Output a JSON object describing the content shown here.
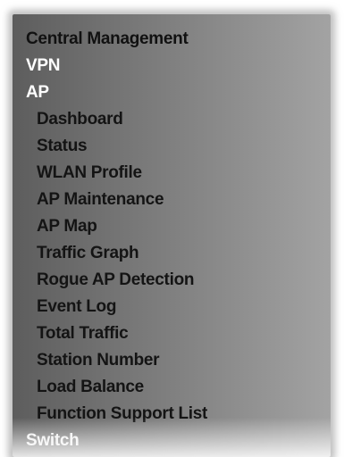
{
  "menu": {
    "top_items": [
      "Central Management",
      "VPN",
      "AP"
    ],
    "ap_submenu": [
      "Dashboard",
      "Status",
      "WLAN Profile",
      "AP Maintenance",
      "AP Map",
      "Traffic Graph",
      "Rogue AP Detection",
      "Event Log",
      "Total Traffic",
      "Station Number",
      "Load Balance",
      "Function Support List"
    ],
    "bottom_item": "Switch"
  }
}
